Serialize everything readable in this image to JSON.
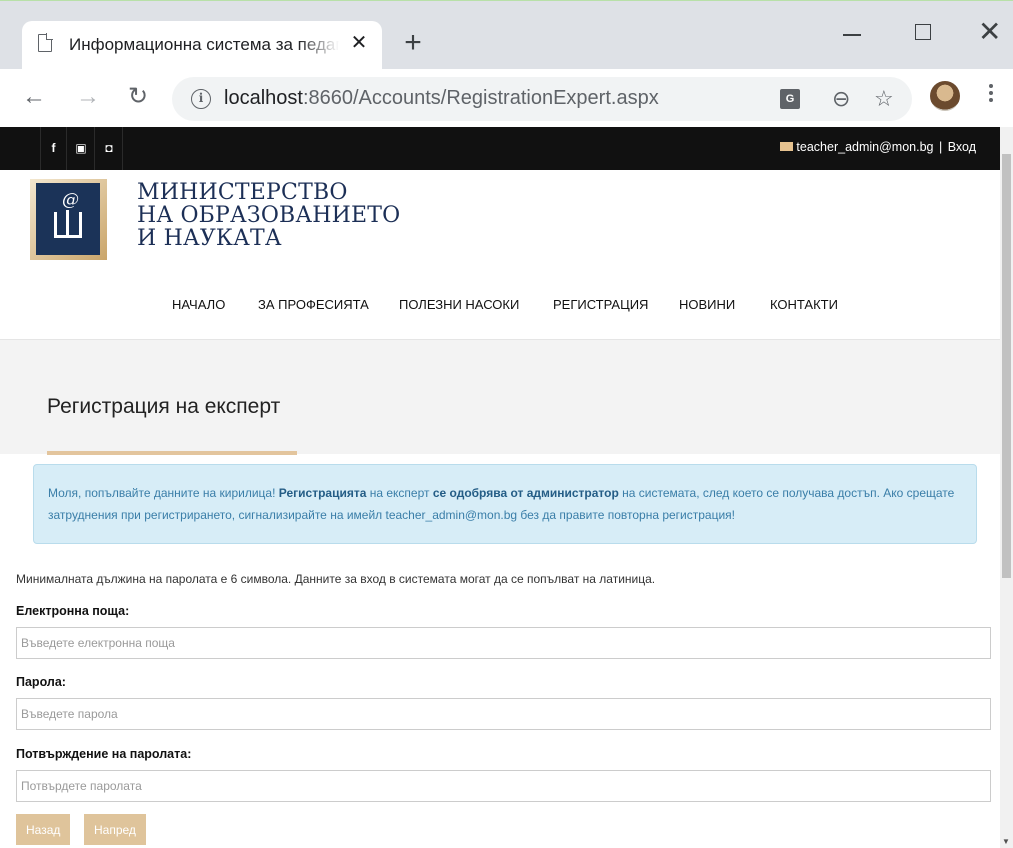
{
  "browser": {
    "tab_title": "Информационна система за педагогически специалисти",
    "tab_close": "✕",
    "new_tab": "+",
    "url_host": "localhost",
    "url_path": ":8660/Accounts/RegistrationExpert.aspx",
    "icons": [
      "page-icon",
      "back-icon",
      "forward-icon",
      "reload-icon",
      "info-icon",
      "translate-icon",
      "zoom-out-icon",
      "star-icon",
      "profile-avatar",
      "menu-icon"
    ]
  },
  "topbar": {
    "social": [
      "f",
      "▣",
      "◘"
    ],
    "email": "teacher_admin@mon.bg",
    "separator": "|",
    "login": "Вход"
  },
  "brand": {
    "line1": "МИНИСТЕРСТВО",
    "line2": "НА ОБРАЗОВАНИЕТО",
    "line3": "И НАУКАТА"
  },
  "nav": {
    "items": [
      "НАЧАЛО",
      "ЗА ПРОФЕСИЯТА",
      "ПОЛЕЗНИ НАСОКИ",
      "РЕГИСТРАЦИЯ",
      "НОВИНИ",
      "КОНТАКТИ"
    ]
  },
  "page": {
    "title": "Регистрация на експерт"
  },
  "alert": {
    "part1": "Моля, попълвайте данните на кирилица! ",
    "bold1": "Регистрацията",
    "part2": " на експерт ",
    "bold2": "се одобрява от администратор",
    "part3": " на системата, след което се получава достъп. Ако срещате затруднения при регистрирането, сигнализирайте на имейл teacher_admin@mon.bg без да правите повторна регистрация!"
  },
  "form": {
    "hint": "Минималната дължина на паролата е 6 символа. Данните за вход в системата могат да се попълват на латиница.",
    "email_label": "Електронна поща:",
    "email_placeholder": "Въведете електронна поща",
    "password_label": "Парола:",
    "password_placeholder": "Въведете парола",
    "confirm_label": "Потвърждение на паролата:",
    "confirm_placeholder": "Потвърдете паролата",
    "back_button": "Назад",
    "next_button": "Напред"
  },
  "colors": {
    "accent": "#dfc49b",
    "brand_navy": "#1c2f56",
    "topbar": "#111111",
    "alert_bg": "#d7edf7"
  }
}
